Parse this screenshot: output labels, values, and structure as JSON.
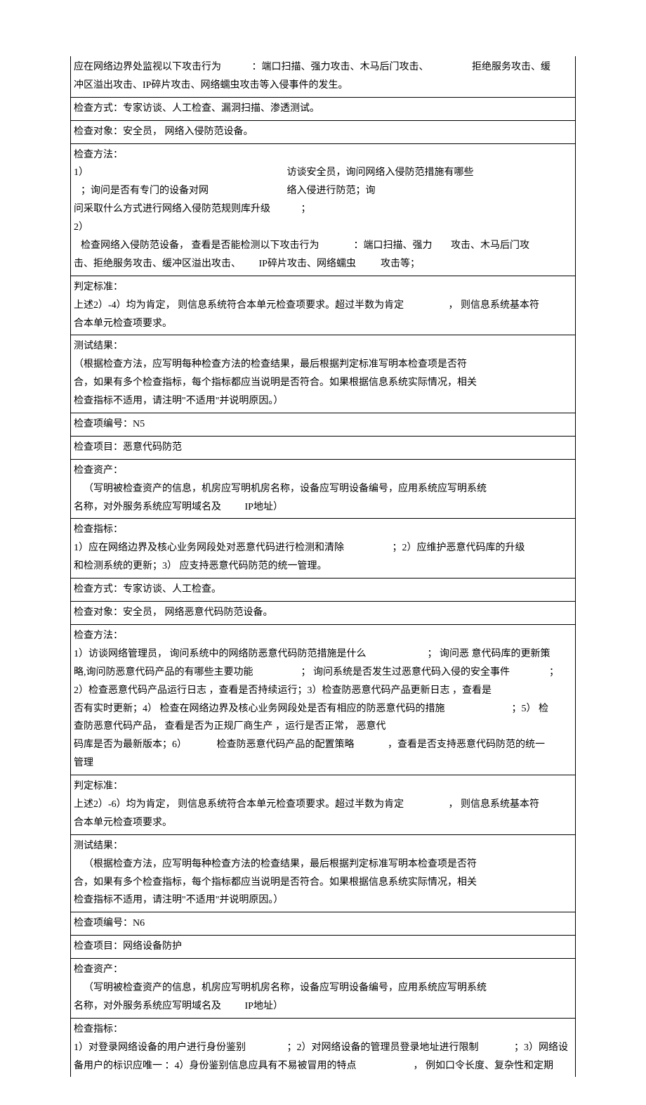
{
  "r1": {
    "l1a": "应在网络边界处监视以下攻击行为",
    "l1b": "：端口扫描、强力攻击、木马后门攻击、",
    "l1c": "拒绝服务攻击、缓",
    "l2": "冲区溢出攻击、IP碎片攻击、网络蠕虫攻击等入侵事件的发生。"
  },
  "r2": "检查方式：专家访谈、人工检查、漏洞扫描、渗透测试。",
  "r3": "检查对象：安全员，  网络入侵防范设备。",
  "r4": {
    "l1": "检查方法：",
    "l2a": "1）",
    "l2b": "访谈安全员，询问网络入侵防范措施有哪些",
    "l3a": "；询问是否有专门的设备对网",
    "l3b": "络入侵进行防范；询",
    "l4a": "问采取什么方式进行网络入侵防范规则库升级",
    "l4b": "；",
    "l5": "2）",
    "l6a": "检查网络入侵防范设备，  查看是否能检测以下攻击行为",
    "l6b": "：端口扫描、强力",
    "l6c": "攻击、木马后门攻",
    "l7a": "击、拒绝服务攻击、缓冲区溢出攻击、",
    "l7b": "IP碎片攻击、网络蠕虫",
    "l7c": "攻击等；"
  },
  "r5": {
    "l1": "判定标准：",
    "l2a": "上述2）-4）均为肯定，  则信息系统符合本单元检查项要求。超过半数为肯定",
    "l2b": "，  则信息系统基本符",
    "l3": "合本单元检查项要求。"
  },
  "r6": {
    "l1": "测试结果：",
    "l2": "（根据检查方法，应写明每种检查方法的检查结果，最后根据判定标准写明本检查项是否符",
    "l3": "合，如果有多个检查指标，每个指标都应当说明是否符合。如果根据信息系统实际情况，相关",
    "l4": "检查指标不适用，请注明\"不适用\"并说明原因。）"
  },
  "r7": "检查项编号：N5",
  "r8": "检查项目：恶意代码防范",
  "r9": {
    "l1": "检查资产：",
    "l2": "（写明被检查资产的信息，机房应写明机房名称，设备应写明设备编号，应用系统应写明系统",
    "l3a": "名称，对外服务系统应写明域名及",
    "l3b": "IP地址）"
  },
  "r10": {
    "l1": "检查指标：",
    "l2a": "1）应在网络边界及核心业务网段处对恶意代码进行检测和清除",
    "l2b": "；2）应维护恶意代码库的升级",
    "l3": "和检测系统的更新；3） 应支持恶意代码防范的统一管理。"
  },
  "r11": "检查方式：专家访谈、人工检查。",
  "r12": "检查对象：安全员，  网络恶意代码防范设备。",
  "r13": {
    "l1": "检查方法：",
    "l2a": "1）访谈网络管理员，  询问系统中的网络防恶意代码防范措施是什么",
    "l2b": "；  询问恶  意代码库的更新策",
    "l3a": "略,询问防恶意代码产品的有哪些主要功能",
    "l3b": "；  询问系统是否发生过恶意代码入侵的安全事件",
    "l3c": "；",
    "l4": "2）检查恶意代码产品运行日志  ，查看是否持续运行；3）检查防恶意代码产品更新日志  ，查看是",
    "l5a": "否有实时更新；4）  检查在网络边界及核心业务网段处是否有相应的防恶意代码的措施",
    "l5b": "；5）  检",
    "l6": "查防恶意代码产品，  查看是否为正规厂商生产  ，运行是否正常，  恶意代",
    "l7a": "码库是否为最新版本；6）",
    "l7b": "检查防恶意代码产品的配置策略",
    "l7c": "，查看是否支持恶意代码防范的统一",
    "l8": "管理"
  },
  "r14": {
    "l1": "判定标准：",
    "l2a": "上述2）-6）均为肯定，  则信息系统符合本单元检查项要求。超过半数为肯定",
    "l2b": "，  则信息系统基本符",
    "l3": "合本单元检查项要求。"
  },
  "r15": {
    "l1": "测试结果：",
    "l2": "（根据检查方法，应写明每种检查方法的检查结果，最后根据判定标准写明本检查项是否符",
    "l3": "合，如果有多个检查指标，每个指标都应当说明是否符合。如果根据信息系统实际情况，相关",
    "l4": "检查指标不适用，请注明\"不适用\"并说明原因。）"
  },
  "r16": "检查项编号：N6",
  "r17": "检查项目：网络设备防护",
  "r18": {
    "l1": "检查资产：",
    "l2": "（写明被检查资产的信息，机房应写明机房名称，设备应写明设备编号，应用系统应写明系统",
    "l3a": "名称，对外服务系统应写明域名及",
    "l3b": "IP地址）"
  },
  "r19": {
    "l1": "检查指标：",
    "l2a": "1）对登录网络设备的用户进行身份鉴别",
    "l2b": "；2）对网络设备的管理员登录地址进行限制",
    "l2c": "；3）网络设",
    "l3a": "备用户的标识应唯一  ：4）身份鉴别信息应具有不易被冒用的特点",
    "l3b": "，  例如口令长度、复杂性和定期"
  }
}
